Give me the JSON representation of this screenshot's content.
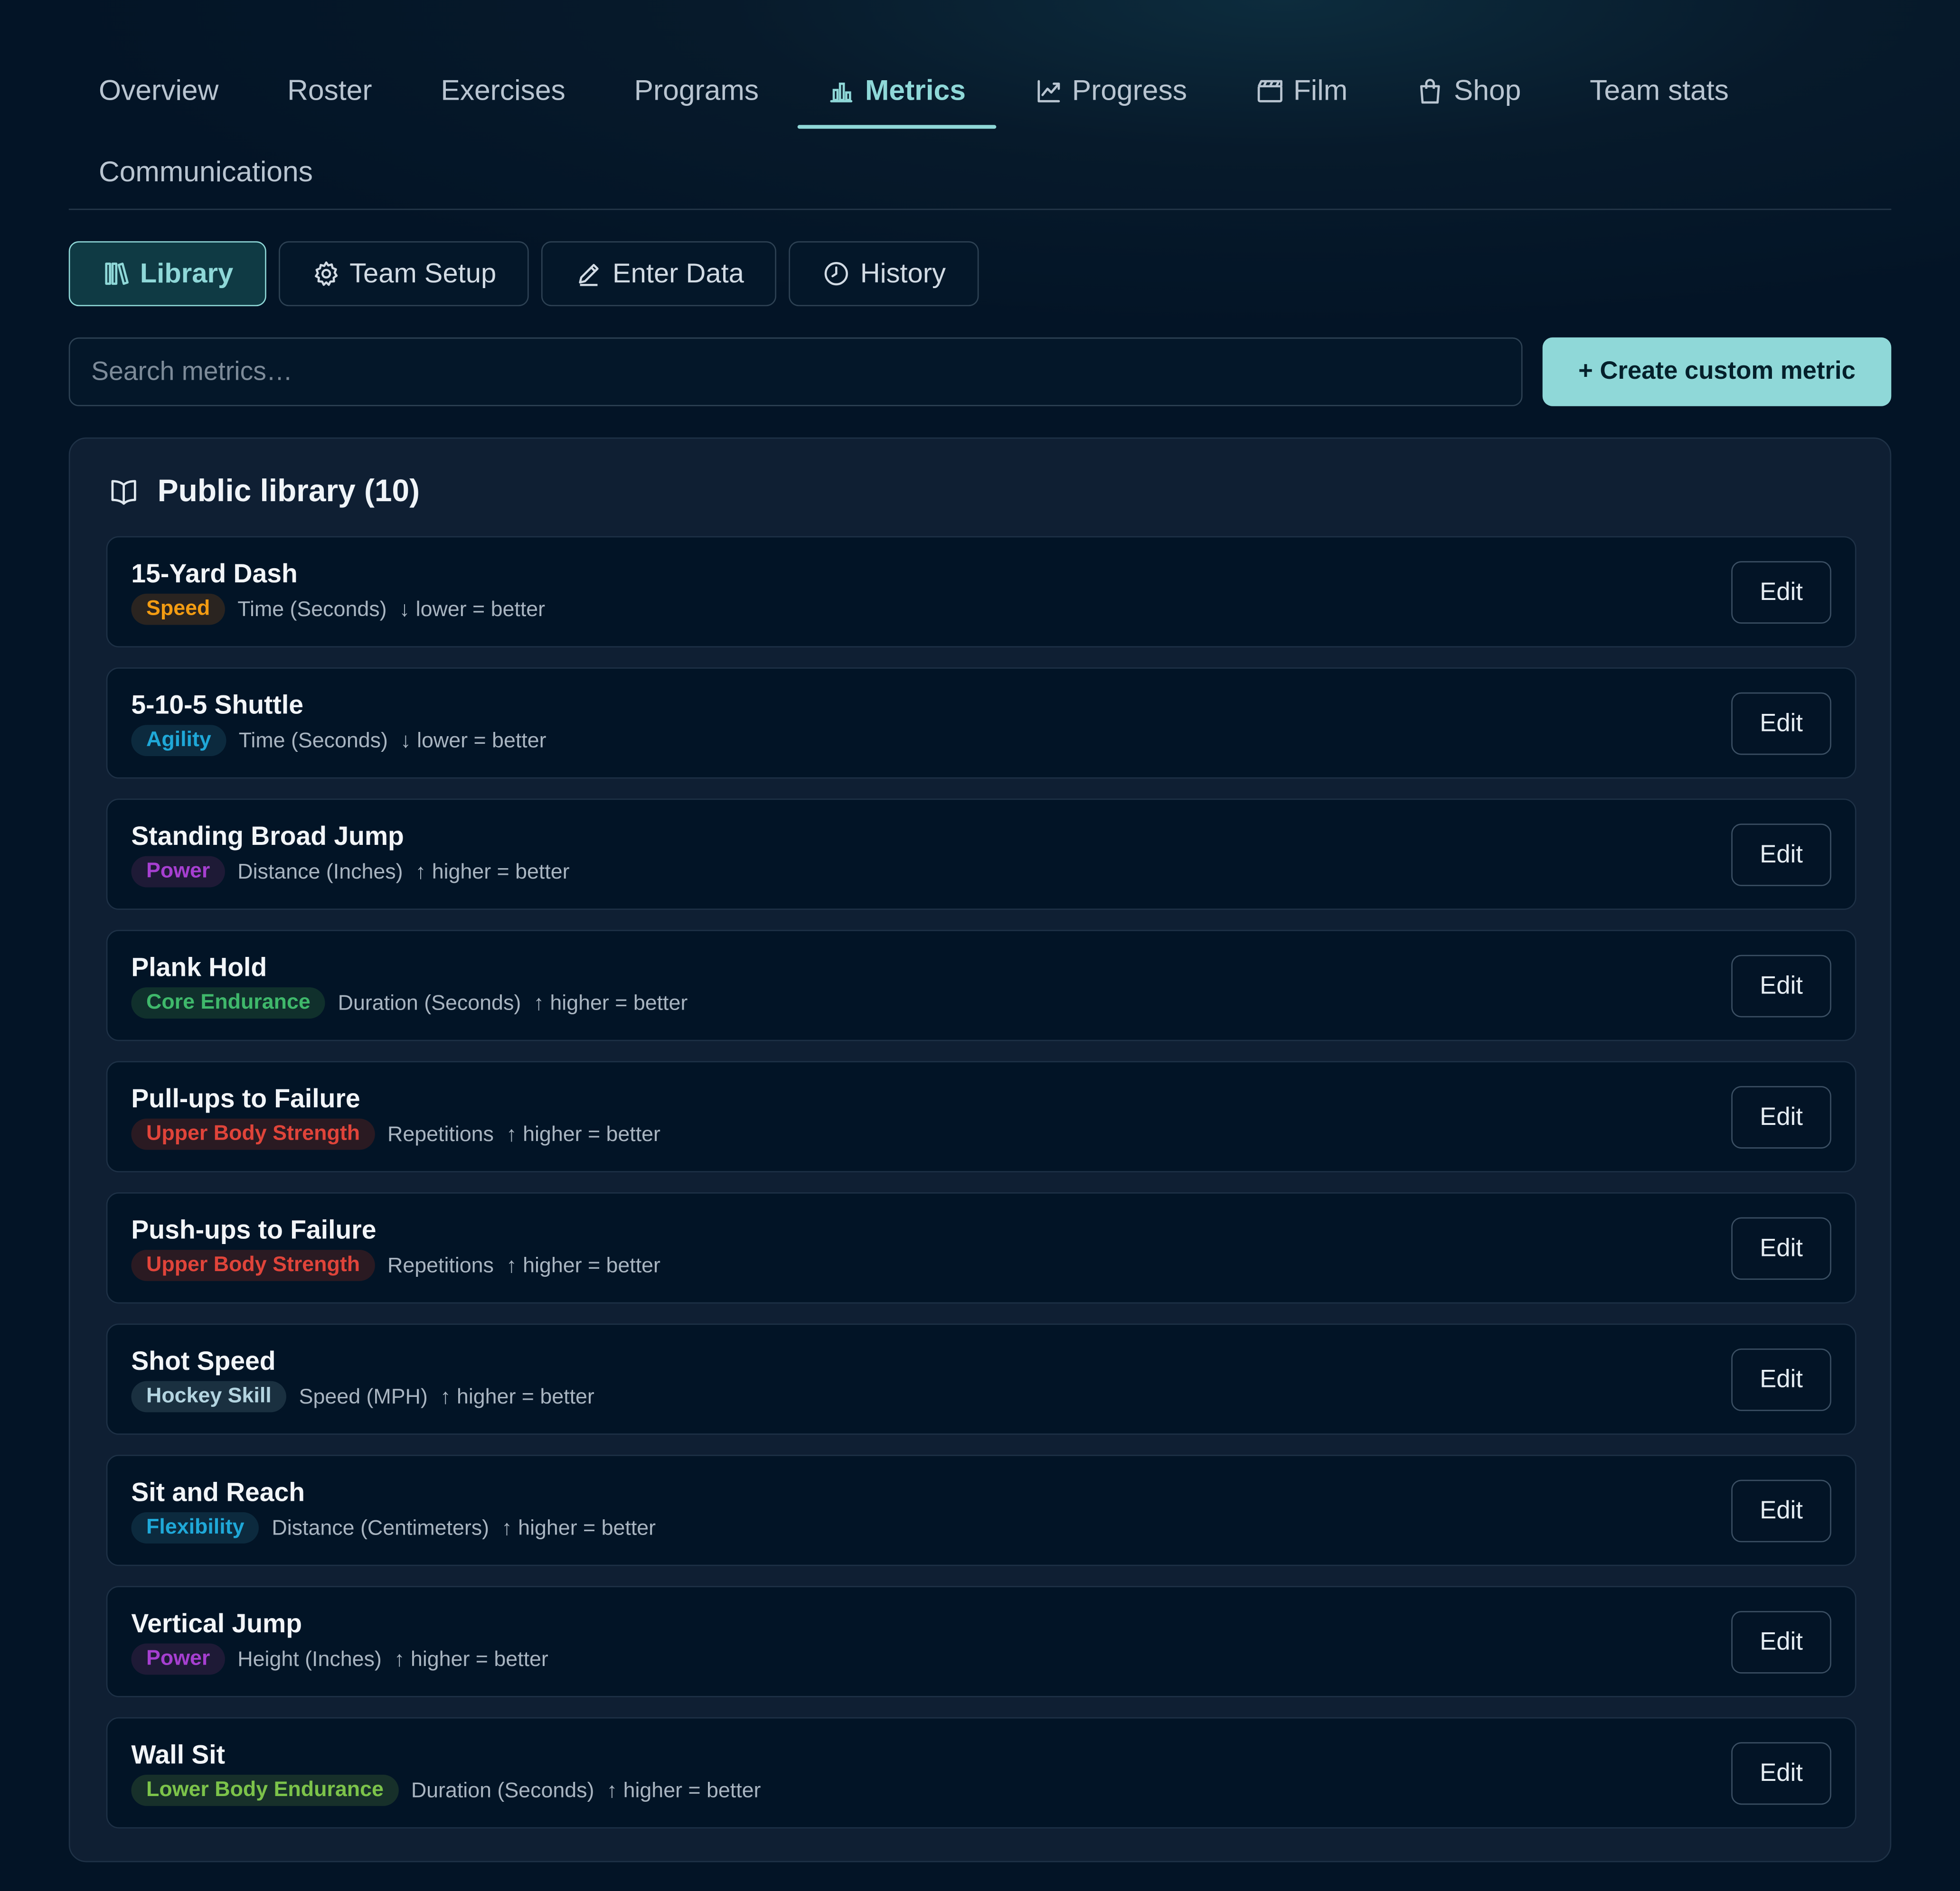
{
  "nav": {
    "tabs": [
      {
        "label": "Overview",
        "icon": null,
        "active": false
      },
      {
        "label": "Roster",
        "icon": null,
        "active": false
      },
      {
        "label": "Exercises",
        "icon": null,
        "active": false
      },
      {
        "label": "Programs",
        "icon": null,
        "active": false
      },
      {
        "label": "Metrics",
        "icon": "bar-chart-icon",
        "active": true
      },
      {
        "label": "Progress",
        "icon": "trend-line-icon",
        "active": false
      },
      {
        "label": "Film",
        "icon": "clapperboard-icon",
        "active": false
      },
      {
        "label": "Shop",
        "icon": "shopping-bag-icon",
        "active": false
      },
      {
        "label": "Team stats",
        "icon": null,
        "active": false
      },
      {
        "label": "Communications",
        "icon": null,
        "active": false
      }
    ]
  },
  "subtabs": [
    {
      "label": "Library",
      "icon": "books-icon",
      "active": true
    },
    {
      "label": "Team Setup",
      "icon": "gear-icon",
      "active": false
    },
    {
      "label": "Enter Data",
      "icon": "pencil-icon",
      "active": false
    },
    {
      "label": "History",
      "icon": "clock-icon",
      "active": false
    }
  ],
  "search": {
    "placeholder": "Search metrics…",
    "value": ""
  },
  "create_button": "+ Create custom metric",
  "library": {
    "title": "Public library (10)",
    "icon": "open-book-icon",
    "edit_label": "Edit",
    "items": [
      {
        "name": "15-Yard Dash",
        "category": "Speed",
        "badge_color": "#f39c12",
        "badge_bg": "#2a2420",
        "unit": "Time (Seconds)",
        "direction": "↓ lower = better"
      },
      {
        "name": "5-10-5 Shuttle",
        "category": "Agility",
        "badge_color": "#1fa8d8",
        "badge_bg": "#0c2a3e",
        "unit": "Time (Seconds)",
        "direction": "↓ lower = better"
      },
      {
        "name": "Standing Broad Jump",
        "category": "Power",
        "badge_color": "#a63fd0",
        "badge_bg": "#1e1a36",
        "unit": "Distance (Inches)",
        "direction": "↑ higher = better"
      },
      {
        "name": "Plank Hold",
        "category": "Core Endurance",
        "badge_color": "#3fb86b",
        "badge_bg": "#10302c",
        "unit": "Duration (Seconds)",
        "direction": "↑ higher = better"
      },
      {
        "name": "Pull-ups to Failure",
        "category": "Upper Body Strength",
        "badge_color": "#e0443a",
        "badge_bg": "#2a1a22",
        "unit": "Repetitions",
        "direction": "↑ higher = better"
      },
      {
        "name": "Push-ups to Failure",
        "category": "Upper Body Strength",
        "badge_color": "#e0443a",
        "badge_bg": "#2a1a22",
        "unit": "Repetitions",
        "direction": "↑ higher = better"
      },
      {
        "name": "Shot Speed",
        "category": "Hockey Skill",
        "badge_color": "#b3d4e0",
        "badge_bg": "#1a3040",
        "unit": "Speed (MPH)",
        "direction": "↑ higher = better"
      },
      {
        "name": "Sit and Reach",
        "category": "Flexibility",
        "badge_color": "#1fa8d8",
        "badge_bg": "#0c2a3e",
        "unit": "Distance (Centimeters)",
        "direction": "↑ higher = better"
      },
      {
        "name": "Vertical Jump",
        "category": "Power",
        "badge_color": "#a63fd0",
        "badge_bg": "#1e1a36",
        "unit": "Height (Inches)",
        "direction": "↑ higher = better"
      },
      {
        "name": "Wall Sit",
        "category": "Lower Body Endurance",
        "badge_color": "#7cc34a",
        "badge_bg": "#17302a",
        "unit": "Duration (Seconds)",
        "direction": "↑ higher = better"
      }
    ]
  }
}
